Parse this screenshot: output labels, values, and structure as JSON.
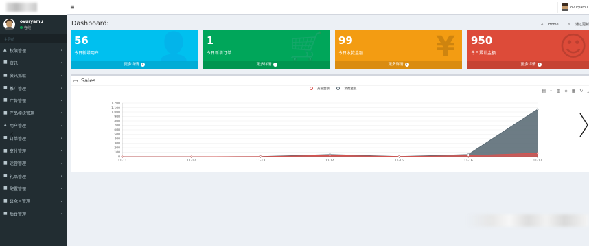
{
  "user": {
    "name": "ovuryamu",
    "status": "在线",
    "top_name": "ovuryamu"
  },
  "sidebar": {
    "header": "主导航",
    "items": [
      {
        "label": "权限管理",
        "icon": "lock-icon"
      },
      {
        "label": "资讯",
        "icon": "book-icon"
      },
      {
        "label": "资讯抓取",
        "icon": "book-icon"
      },
      {
        "label": "推广管理",
        "icon": "book-icon"
      },
      {
        "label": "广告管理",
        "icon": "book-icon"
      },
      {
        "label": "产品模块管理",
        "icon": "book-icon"
      },
      {
        "label": "用户管理",
        "icon": "user-icon"
      },
      {
        "label": "订单管理",
        "icon": "book-icon"
      },
      {
        "label": "支付管理",
        "icon": "book-icon"
      },
      {
        "label": "运营管理",
        "icon": "book-icon"
      },
      {
        "label": "礼品管理",
        "icon": "book-icon"
      },
      {
        "label": "配置管理",
        "icon": "book-icon"
      },
      {
        "label": "公众号管理",
        "icon": "book-icon"
      },
      {
        "label": "后台管理",
        "icon": "book-icon"
      }
    ]
  },
  "page": {
    "title": "Dashboard:"
  },
  "breadcrumb": {
    "home": "Home",
    "current": "通过更新"
  },
  "boxes": [
    {
      "value": "56",
      "label": "今日新增用户",
      "more": "更多详情",
      "icon": "user-add-icon",
      "color": "#00c0ef"
    },
    {
      "value": "1",
      "label": "今日新增订单",
      "more": "更多详情",
      "icon": "cart-icon",
      "color": "#00a65a"
    },
    {
      "value": "99",
      "label": "今日收款金额",
      "more": "更多详情",
      "icon": "yen-icon",
      "color": "#f39c12"
    },
    {
      "value": "950",
      "label": "今日累计金额",
      "more": "更多详情",
      "icon": "smile-icon",
      "color": "#dd4b39"
    }
  ],
  "sales": {
    "title": "Sales"
  },
  "chart_data": {
    "type": "area",
    "x": [
      "11-11",
      "11-12",
      "11-13",
      "11-14",
      "11-15",
      "11-16",
      "11-17"
    ],
    "series": [
      {
        "name": "充值金额",
        "color": "#d9534f",
        "values": [
          0,
          0,
          3,
          30,
          5,
          25,
          80
        ]
      },
      {
        "name": "消费金额",
        "color": "#546570",
        "values": [
          0,
          0,
          5,
          50,
          5,
          50,
          1060
        ]
      }
    ],
    "ylim": [
      0,
      1200
    ],
    "yticks": [
      "0",
      "100",
      "200",
      "300",
      "400",
      "500",
      "600",
      "700",
      "800",
      "900",
      "1,000",
      "1,100",
      "1,200"
    ],
    "grid": true,
    "legend": "top-center"
  }
}
